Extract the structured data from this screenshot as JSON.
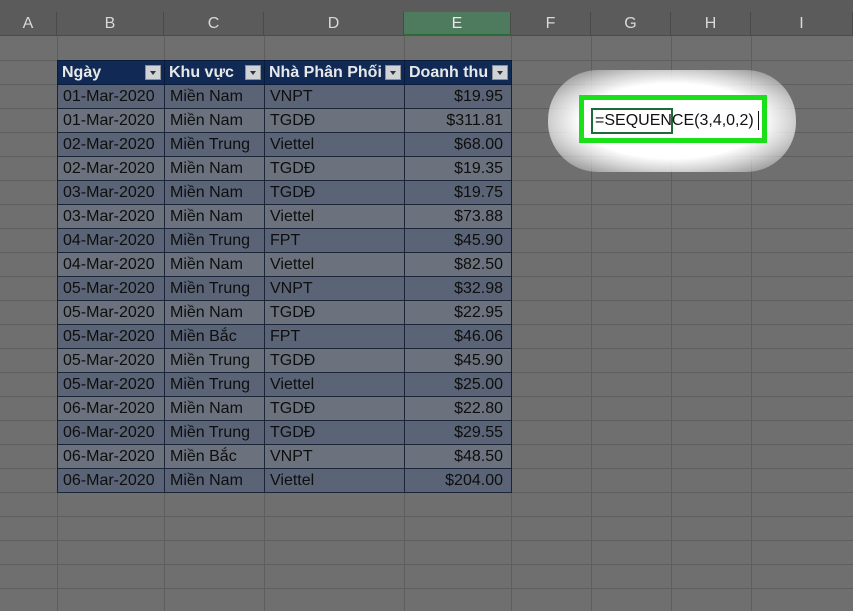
{
  "columns": [
    "A",
    "B",
    "C",
    "D",
    "E",
    "F",
    "G",
    "H",
    "I"
  ],
  "table": {
    "headers": [
      "Ngày",
      "Khu vực",
      "Nhà Phân Phối",
      "Doanh thu"
    ],
    "rows": [
      [
        "01-Mar-2020",
        "Miền Nam",
        "VNPT",
        "$19.95"
      ],
      [
        "01-Mar-2020",
        "Miền Nam",
        "TGDĐ",
        "$311.81"
      ],
      [
        "02-Mar-2020",
        "Miền Trung",
        "Viettel",
        "$68.00"
      ],
      [
        "02-Mar-2020",
        "Miền Nam",
        "TGDĐ",
        "$19.35"
      ],
      [
        "03-Mar-2020",
        "Miền Nam",
        "TGDĐ",
        "$19.75"
      ],
      [
        "03-Mar-2020",
        "Miền Nam",
        "Viettel",
        "$73.88"
      ],
      [
        "04-Mar-2020",
        "Miền Trung",
        "FPT",
        "$45.90"
      ],
      [
        "04-Mar-2020",
        "Miền Nam",
        "Viettel",
        "$82.50"
      ],
      [
        "05-Mar-2020",
        "Miền Trung",
        "VNPT",
        "$32.98"
      ],
      [
        "05-Mar-2020",
        "Miền Nam",
        "TGDĐ",
        "$22.95"
      ],
      [
        "05-Mar-2020",
        "Miền Bắc",
        "FPT",
        "$46.06"
      ],
      [
        "05-Mar-2020",
        "Miền Trung",
        "TGDĐ",
        "$45.90"
      ],
      [
        "05-Mar-2020",
        "Miền Trung",
        "Viettel",
        "$25.00"
      ],
      [
        "06-Mar-2020",
        "Miền Nam",
        "TGDĐ",
        "$22.80"
      ],
      [
        "06-Mar-2020",
        "Miền Trung",
        "TGDĐ",
        "$29.55"
      ],
      [
        "06-Mar-2020",
        "Miền Bắc",
        "VNPT",
        "$48.50"
      ],
      [
        "06-Mar-2020",
        "Miền Nam",
        "Viettel",
        "$204.00"
      ]
    ]
  },
  "formula_cell": {
    "text": "=SEQUENCE(3,4,0,2)",
    "highlight_color": "#19e019"
  },
  "selected_column": "E"
}
